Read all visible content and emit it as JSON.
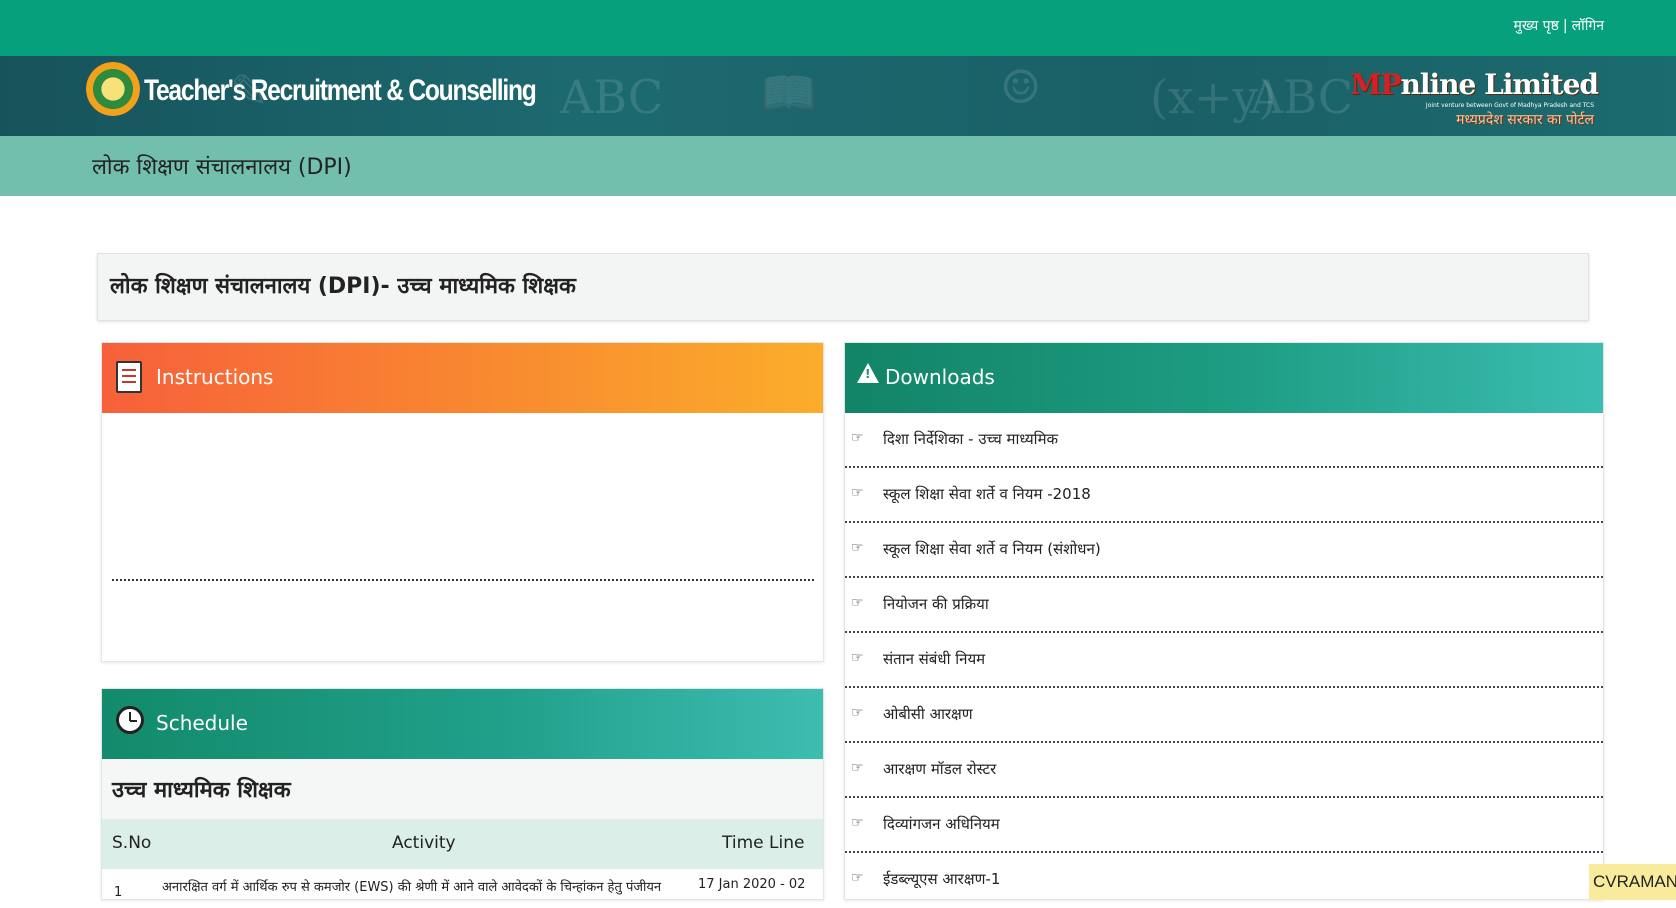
{
  "topbar": {
    "home_link": "मुख्य पृष्ठ",
    "separator": "|",
    "login_link": "लॉगिन"
  },
  "banner": {
    "title": "Teacher's Recruitment & Counselling",
    "emblem_icon": "mp-govt-emblem-icon",
    "partner_logo": {
      "text_red": "MP",
      "text_main": "nline Limited",
      "jv_text": "Joint venture between Govt of Madhya Pradesh and TCS",
      "tagline": "मध्यप्रदेश सरकार का पोर्टल"
    }
  },
  "subbar": {
    "department": "लोक शिक्षण संचालनालय (DPI)"
  },
  "page": {
    "heading": "लोक शिक्षण संचालनालय (DPI)- उच्च माध्यमिक शिक्षक"
  },
  "instructions": {
    "title": "Instructions",
    "icon": "document-icon",
    "accent": "#f7603a"
  },
  "schedule": {
    "title": "Schedule",
    "icon": "clock-icon",
    "subheading": "उच्च माध्यमिक शिक्षक",
    "columns": [
      "S.No",
      "Activity",
      "Time Line"
    ],
    "rows": [
      {
        "sno": "1",
        "activity": "अनारक्षित वर्ग में आर्थिक रुप से कमजोर (EWS) की श्रेणी में आने वाले आवेदकों के चिन्हांकन हेतु पंजीयन",
        "timeline": "17 Jan 2020 - 02"
      }
    ]
  },
  "downloads": {
    "title": "Downloads",
    "icon": "warning-icon",
    "bullet_icon": "pointing-hand-icon",
    "items": [
      "दिशा निर्देशिका - उच्च माध्यमिक",
      "स्कूल शिक्षा सेवा शर्ते व नियम -2018",
      "स्कूल शिक्षा सेवा शर्ते व नियम (संशोधन)",
      "नियोजन की प्रक्रिया",
      "संतान संबंधी नियम",
      "ओबीसी आरक्षण",
      "आरक्षण मॉडल रोस्टर",
      "दिव्यांगजन अधिनियम",
      "ईडब्ल्यूएस आरक्षण-1"
    ]
  },
  "watermark": "CVRAMAN",
  "colors": {
    "topbar": "#07a07c",
    "banner": "#17535b",
    "subbar": "#72bfae",
    "instructions_head": "#f88a30",
    "teal_head": "#1d9c82"
  }
}
